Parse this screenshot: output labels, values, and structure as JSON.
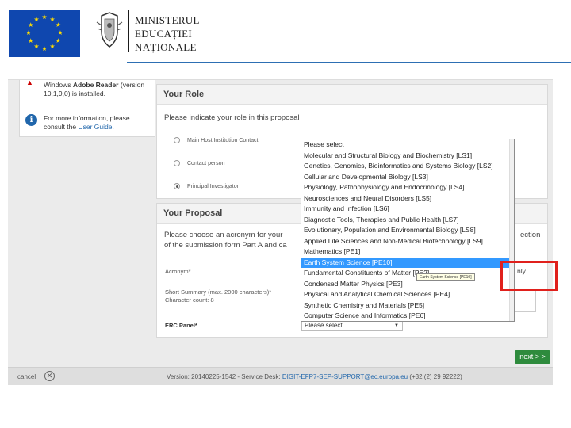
{
  "header": {
    "ministry_lines": [
      "MINISTERUL",
      "EDUCAȚIEI",
      "NAȚIONALE"
    ]
  },
  "sidebar": {
    "reader_line1": "Windows",
    "reader_bold": "Adobe Reader",
    "reader_version": "(version 10,1,9,0) is installed.",
    "info_text": "For more information, please consult the ",
    "info_link": "User Guide."
  },
  "role": {
    "title": "Your Role",
    "prompt": "Please indicate your role in this proposal",
    "options": [
      {
        "label": "Main Host Institution Contact",
        "checked": false
      },
      {
        "label": "Contact person",
        "checked": false
      },
      {
        "label": "Principal Investigator",
        "checked": true
      }
    ]
  },
  "proposal": {
    "title": "Your Proposal",
    "prompt_line1": "Please choose an acronym for your",
    "prompt_line1_end": "ection",
    "prompt_line2": "of the submission form Part A and ca",
    "acronym_label": "Acronym*",
    "summary_label": "Short Summary (max. 2000 characters)*",
    "char_count": "Character count: 8",
    "erc_label": "ERC Panel*",
    "erc_value": "Please select",
    "only_fragment": "nly"
  },
  "dropdown": {
    "items": [
      "Please select",
      "Molecular and Structural Biology and Biochemistry [LS1]",
      "Genetics, Genomics, Bioinformatics and Systems Biology [LS2]",
      "Cellular and Developmental Biology [LS3]",
      "Physiology, Pathophysiology and Endocrinology [LS4]",
      "Neurosciences and Neural Disorders [LS5]",
      "Immunity and Infection [LS6]",
      "Diagnostic Tools, Therapies and Public Health [LS7]",
      "Evolutionary, Population and Environmental Biology [LS8]",
      "Applied Life Sciences and Non-Medical Biotechnology [LS9]",
      "Mathematics [PE1]",
      "Earth System Science [PE10]",
      "Fundamental Constituents of Matter [PE2]",
      "Condensed Matter Physics [PE3]",
      "Physical and Analytical Chemical Sciences [PE4]",
      "Synthetic Chemistry and Materials [PE5]",
      "Computer Science and Informatics [PE6]"
    ],
    "selected_index": 11,
    "tooltip": "Earth System Science [PE10]"
  },
  "actions": {
    "next_label": "next > >"
  },
  "footer": {
    "cancel": "cancel",
    "version": "Version: 20140225-1542 - Service Desk: ",
    "email": "DIGIT-EFP7-SEP-SUPPORT@ec.europa.eu",
    "phone": " (+32 (2) 29 92222)"
  },
  "colors": {
    "eu_blue": "#0f47af",
    "eu_gold": "#ffdd00",
    "selection_blue": "#3399ff",
    "next_green": "#2e8b3d",
    "highlight_red": "#e0201c",
    "link_blue": "#2066ab"
  },
  "icons": [
    "eu-flag-icon",
    "ministry-crest-icon",
    "pdf-icon",
    "info-icon",
    "radio-icon",
    "chevron-down-icon",
    "cancel-x-icon"
  ]
}
